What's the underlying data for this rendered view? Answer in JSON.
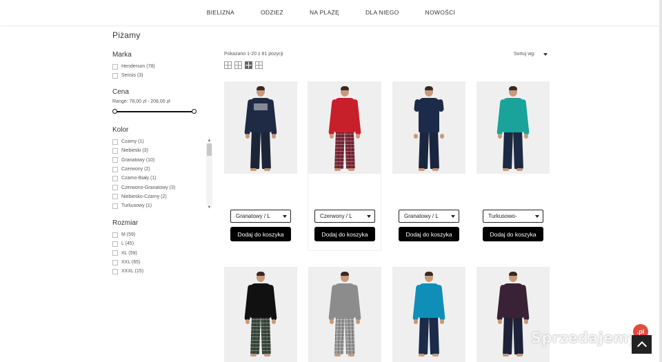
{
  "nav": {
    "items": [
      "BIELIZNA",
      "ODZIEŻ",
      "NA PLAŻĘ",
      "DLA NIEGO",
      "NOWOŚCI"
    ]
  },
  "page": {
    "title": "Piżamy"
  },
  "filters": {
    "marka": {
      "title": "Marka",
      "options": [
        "Henderson (78)",
        "Sensis (3)"
      ]
    },
    "cena": {
      "title": "Cena",
      "range_text": "Range: 78,00 zł - 208,00 zł"
    },
    "kolor": {
      "title": "Kolor",
      "options": [
        "Czarny (1)",
        "Niebieski (3)",
        "Granatowy (10)",
        "Czerwony (2)",
        "Czarno-Biały (1)",
        "Czerwono-Granatowy (3)",
        "Niebiesko-Czarny (2)",
        "Turkusowy (1)"
      ]
    },
    "rozmiar": {
      "title": "Rozmiar",
      "options": [
        "M (59)",
        "L (45)",
        "XL (59)",
        "XXL (65)",
        "XXXL (15)"
      ]
    }
  },
  "listing": {
    "count_text": "Pokazano 1-20 z 81 pozycji",
    "sort_label": "Sortuj wg:"
  },
  "products": [
    {
      "variant": "Granatowy / L",
      "add_label": "Dodaj do koszyka",
      "top": "#1f2a44",
      "bottom": "#1c2438",
      "print": true
    },
    {
      "variant": "Czerwony / L",
      "add_label": "Dodaj do koszyka",
      "top": "#c8202b",
      "bottom": "#7d2a3a",
      "plaid": true
    },
    {
      "variant": "Granatowy / L",
      "add_label": "Dodaj do koszyka",
      "top": "#1d2b4a",
      "bottom": "#1a2540"
    },
    {
      "variant": "Turkusowo-",
      "add_label": "Dodaj do koszyka",
      "top": "#1aa39a",
      "bottom": "#1d2a44"
    }
  ],
  "products_row2": [
    {
      "top": "#111111",
      "bottom": "#3c4b3e",
      "plaid": true
    },
    {
      "top": "#8c8c8c",
      "bottom": "#9a9a9a",
      "plaid": true
    },
    {
      "top": "#0f8fb8",
      "bottom": "#1b2b48"
    },
    {
      "top": "#3a2236",
      "bottom": "#1d2238"
    }
  ],
  "watermark": {
    "text": "Sprzedajemy",
    "badge": ".pl"
  },
  "colors": {
    "button_bg": "#000000",
    "button_text": "#ffffff"
  }
}
